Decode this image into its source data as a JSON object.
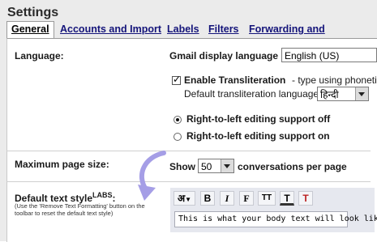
{
  "header": {
    "title": "Settings"
  },
  "tabs": [
    {
      "label": "General",
      "active": true
    },
    {
      "label": "Accounts and Import"
    },
    {
      "label": "Labels"
    },
    {
      "label": "Filters"
    },
    {
      "label": "Forwarding and POP/IMAP"
    }
  ],
  "language": {
    "section_label": "Language:",
    "display_label": "Gmail display language",
    "display_value": "English (US)",
    "translit_checked": true,
    "translit_label": "Enable Transliteration",
    "translit_hint": "- type using phonetic",
    "default_translit_label": "Default transliteration language:",
    "default_translit_value": "हिन्दी",
    "rtl_off_label": "Right-to-left editing support off",
    "rtl_on_label": "Right-to-left editing support on",
    "rtl_selected": "off"
  },
  "page_size": {
    "section_label": "Maximum page size:",
    "show_label": "Show",
    "value": "50",
    "suffix": "conversations per page"
  },
  "text_style": {
    "section_label": "Default text style",
    "badge": "LABS",
    "colon": ":",
    "hint": "(Use the 'Remove Text Formatting' button on the toolbar to reset the default text style)",
    "toolbar": {
      "font": "अ",
      "bold": "B",
      "italic": "I",
      "font_face": "F",
      "size": "TT",
      "color": "T",
      "remove": "T"
    },
    "preview": "This is what your body text will look like."
  },
  "colors": {
    "tab_link": "#14147a",
    "toolbar_bg": "#e6e8ef",
    "arrow": "#a59ee6"
  }
}
